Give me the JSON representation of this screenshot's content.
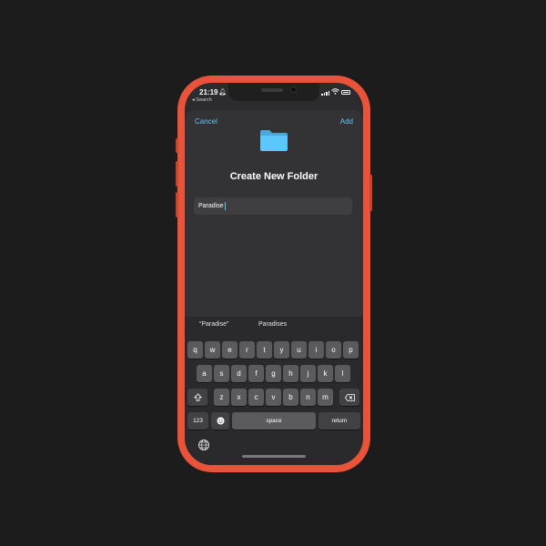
{
  "status_bar": {
    "time": "21:19",
    "back_label": "◂ Search"
  },
  "nav": {
    "cancel_label": "Cancel",
    "add_label": "Add"
  },
  "dialog": {
    "title": "Create New Folder",
    "folder_name_value": "Paradise"
  },
  "keyboard": {
    "suggestions": [
      "“Paradise”",
      "Paradises"
    ],
    "row1": [
      "q",
      "w",
      "e",
      "r",
      "t",
      "y",
      "u",
      "i",
      "o",
      "p"
    ],
    "row2": [
      "a",
      "s",
      "d",
      "f",
      "g",
      "h",
      "j",
      "k",
      "l"
    ],
    "row3": [
      "z",
      "x",
      "c",
      "v",
      "b",
      "n",
      "m"
    ],
    "shift_icon": "shift-icon",
    "delete_icon": "delete-icon",
    "numbers_label": "123",
    "emoji_icon": "emoji-icon",
    "space_label": "space",
    "return_label": "return",
    "globe_icon": "globe-icon"
  },
  "colors": {
    "phone_frame": "#e8533a",
    "accent": "#5ac8fa",
    "folder": "#5ac8fa"
  }
}
